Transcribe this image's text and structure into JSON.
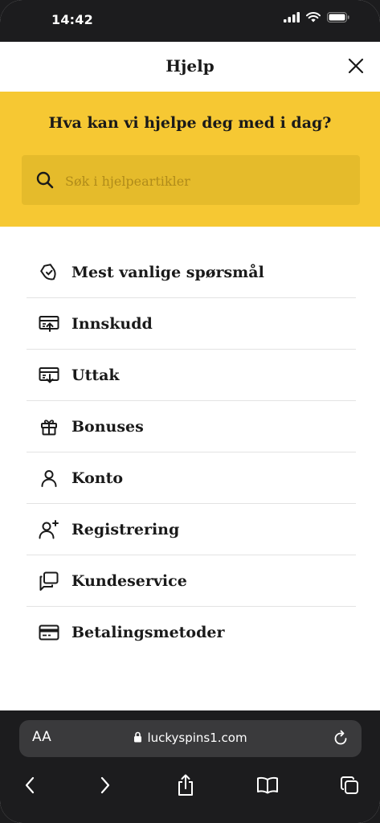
{
  "status_bar": {
    "time": "14:42"
  },
  "header": {
    "title": "Hjelp"
  },
  "hero": {
    "title": "Hva kan vi hjelpe deg med i dag?",
    "search_placeholder": "Søk i hjelpeartikler"
  },
  "help_items": [
    {
      "label": "Mest vanlige spørsmål",
      "icon": "faq-shield-icon"
    },
    {
      "label": "Innskudd",
      "icon": "deposit-icon"
    },
    {
      "label": "Uttak",
      "icon": "withdrawal-icon"
    },
    {
      "label": "Bonuses",
      "icon": "gift-icon"
    },
    {
      "label": "Konto",
      "icon": "user-icon"
    },
    {
      "label": "Registrering",
      "icon": "user-add-icon"
    },
    {
      "label": "Kundeservice",
      "icon": "chat-icon"
    },
    {
      "label": "Betalingsmetoder",
      "icon": "credit-card-icon"
    }
  ],
  "browser": {
    "text_size_label": "AA",
    "url": "luckyspins1.com"
  },
  "colors": {
    "accent_yellow": "#f6c833",
    "search_bg": "#e5bb2b",
    "dark_chrome": "#1c1c1e"
  }
}
